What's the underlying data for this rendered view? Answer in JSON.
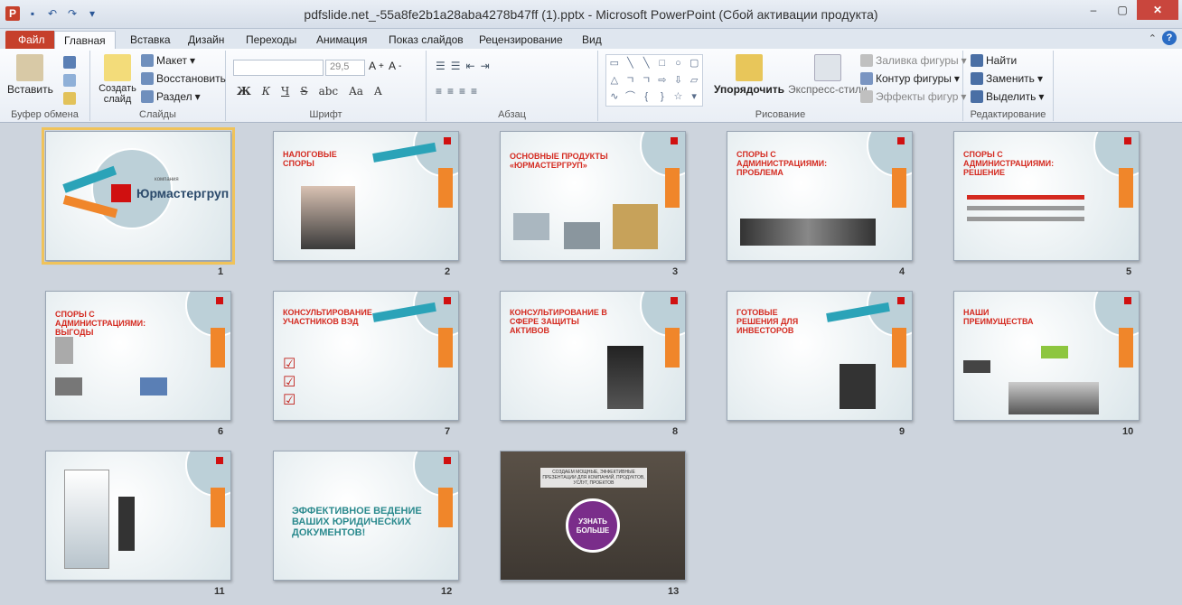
{
  "window": {
    "title": "pdfslide.net_-55a8fe2b1a28aba4278b47ff (1).pptx - Microsoft PowerPoint (Сбой активации продукта)",
    "minimize": "–",
    "maximize": "▢",
    "close": "✕"
  },
  "tabs": [
    {
      "label": "Файл"
    },
    {
      "label": "Главная"
    },
    {
      "label": "Вставка"
    },
    {
      "label": "Дизайн"
    },
    {
      "label": "Переходы"
    },
    {
      "label": "Анимация"
    },
    {
      "label": "Показ слайдов"
    },
    {
      "label": "Рецензирование"
    },
    {
      "label": "Вид"
    }
  ],
  "ribbon": {
    "clipboard": {
      "paste": "Вставить",
      "label": "Буфер обмена"
    },
    "slides": {
      "create": "Создать слайд",
      "layout": "Макет",
      "reset": "Восстановить",
      "section": "Раздел",
      "label": "Слайды"
    },
    "font": {
      "size": "29,5",
      "label": "Шрифт",
      "bold": "Ж",
      "italic": "К",
      "underline": "Ч",
      "strike": "S",
      "spacing": "abc",
      "case": "Aa",
      "color": "A"
    },
    "paragraph": {
      "label": "Абзац"
    },
    "drawing": {
      "arrange": "Упорядочить",
      "quick_styles": "Экспресс-стили",
      "fill": "Заливка фигуры",
      "outline": "Контур фигуры",
      "effects": "Эффекты фигур",
      "label": "Рисование"
    },
    "editing": {
      "find": "Найти",
      "replace": "Заменить",
      "select": "Выделить",
      "label": "Редактирование"
    }
  },
  "slides": [
    {
      "num": "1",
      "title": "Юрмастергруп",
      "subtitle": "компания"
    },
    {
      "num": "2",
      "title": "НАЛОГОВЫЕ СПОРЫ"
    },
    {
      "num": "3",
      "title": "ОСНОВНЫЕ ПРОДУКТЫ «ЮРМАСТЕРГРУП»"
    },
    {
      "num": "4",
      "title": "СПОРЫ С АДМИНИСТРАЦИЯМИ: ПРОБЛЕМА"
    },
    {
      "num": "5",
      "title": "СПОРЫ С АДМИНИСТРАЦИЯМИ: РЕШЕНИЕ"
    },
    {
      "num": "6",
      "title": "СПОРЫ С АДМИНИСТРАЦИЯМИ: ВЫГОДЫ"
    },
    {
      "num": "7",
      "title": "КОНСУЛЬТИРОВАНИЕ УЧАСТНИКОВ ВЭД"
    },
    {
      "num": "8",
      "title": "КОНСУЛЬТИРОВАНИЕ В СФЕРЕ ЗАЩИТЫ АКТИВОВ"
    },
    {
      "num": "9",
      "title": "ГОТОВЫЕ РЕШЕНИЯ ДЛЯ ИНВЕСТОРОВ"
    },
    {
      "num": "10",
      "title": "НАШИ ПРЕИМУЩЕСТВА"
    },
    {
      "num": "11",
      "title": ""
    },
    {
      "num": "12",
      "title": "ЭФФЕКТИВНОЕ ВЕДЕНИЕ ВАШИХ ЮРИДИЧЕСКИХ ДОКУМЕНТОВ!"
    },
    {
      "num": "13",
      "title": "УЗНАТЬ БОЛЬШЕ",
      "banner": "СОЗДАЕМ МОЩНЫЕ, ЭФФЕКТИВНЫЕ ПРЕЗЕНТАЦИИ ДЛЯ КОМПАНИЙ, ПРОДУКТОВ, УСЛУГ, ПРОЕКТОВ"
    }
  ]
}
